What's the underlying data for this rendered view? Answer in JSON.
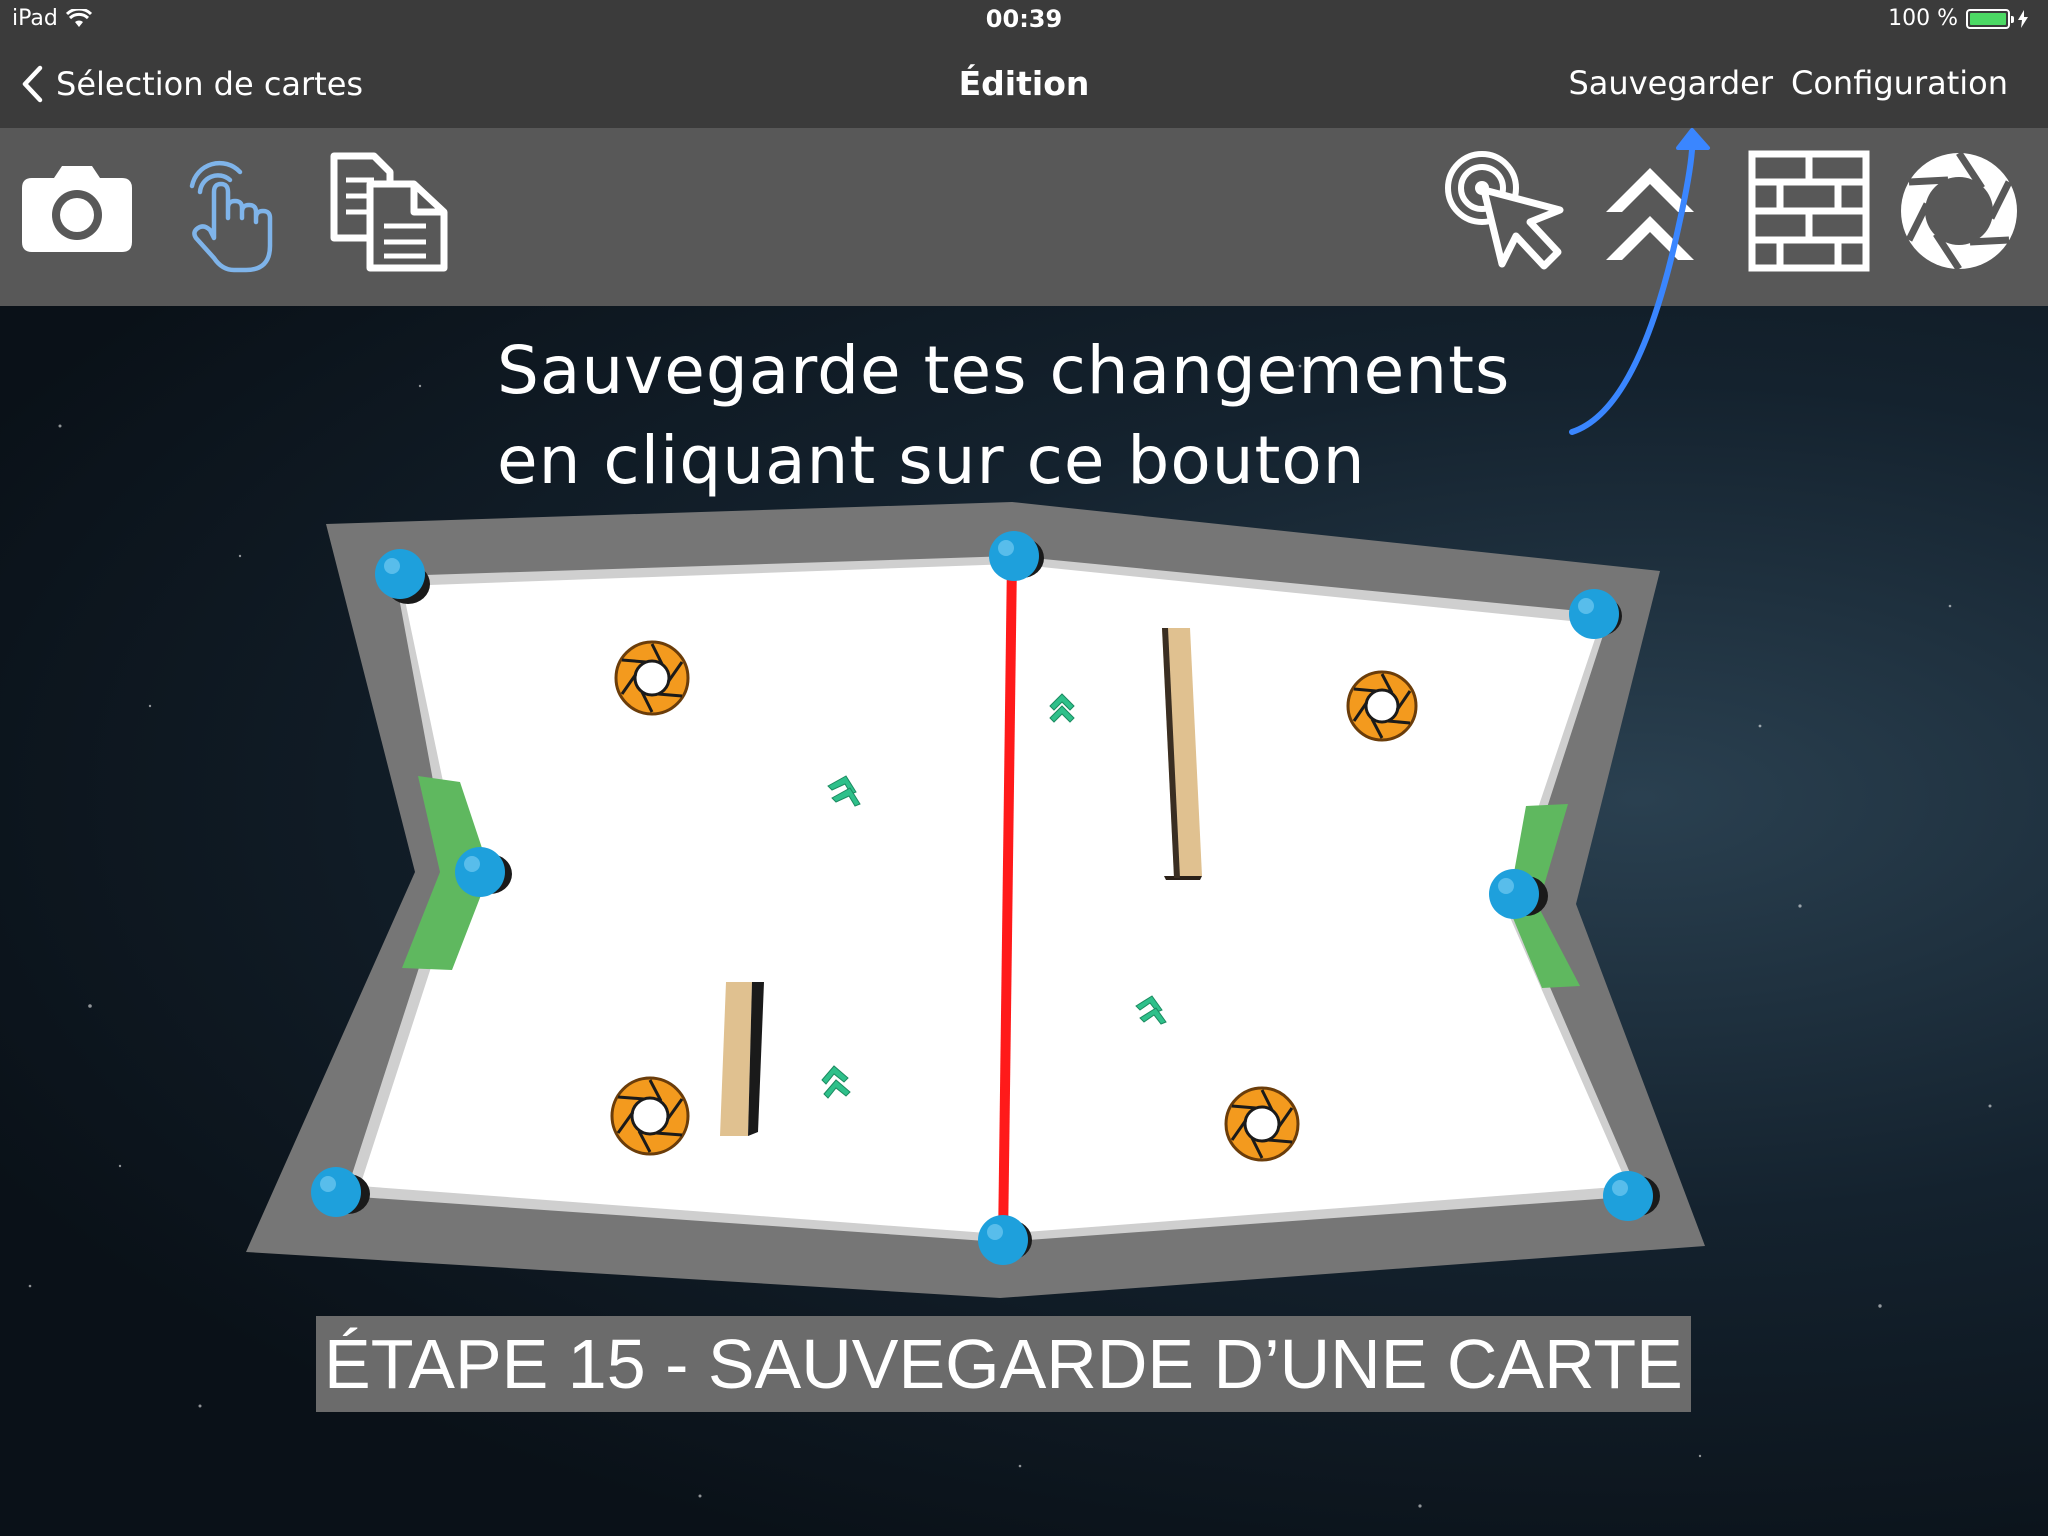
{
  "status_bar": {
    "device": "iPad",
    "time": "00:39",
    "battery_text": "100 %",
    "battery_level": 1.0
  },
  "nav": {
    "back_label": "Sélection de cartes",
    "title": "Édition",
    "save_label": "Sauvegarder",
    "config_label": "Configuration"
  },
  "toolbar": {
    "left_tools": [
      "camera-icon",
      "touch-hand-icon",
      "copy-documents-icon"
    ],
    "right_tools": [
      "select-cursor-icon",
      "accelerator-chevrons-icon",
      "wall-bricks-icon",
      "portal-aperture-icon"
    ],
    "active_tool": "touch-hand-icon"
  },
  "instruction": {
    "line1": "Sauvegarde  tes  changements",
    "line2": "en cliquant sur ce bouton"
  },
  "caption": {
    "text": "ÉTAPE 15 - SAUVEGARDE D’UNE CARTE"
  },
  "colors": {
    "bar": "#3b3b3b",
    "toolbar": "#585858",
    "active_tool": "#7fb4ea",
    "arrow": "#3a86ff",
    "midline": "#ff0000",
    "goal": "#5fb85f",
    "control_point": "#1ea0dc",
    "portal": "#f39a1e",
    "accelerator": "#2ec08a"
  }
}
